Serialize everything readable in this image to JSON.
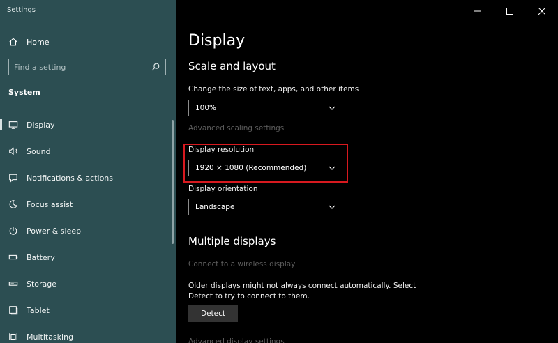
{
  "app": {
    "title": "Settings"
  },
  "sidebar": {
    "home_label": "Home",
    "search_placeholder": "Find a setting",
    "section": "System",
    "items": [
      {
        "label": "Display",
        "icon": "monitor-icon",
        "active": true
      },
      {
        "label": "Sound",
        "icon": "speaker-icon"
      },
      {
        "label": "Notifications & actions",
        "icon": "notification-icon"
      },
      {
        "label": "Focus assist",
        "icon": "moon-icon"
      },
      {
        "label": "Power & sleep",
        "icon": "power-icon"
      },
      {
        "label": "Battery",
        "icon": "battery-icon"
      },
      {
        "label": "Storage",
        "icon": "storage-icon"
      },
      {
        "label": "Tablet",
        "icon": "tablet-icon"
      },
      {
        "label": "Multitasking",
        "icon": "multitasking-icon"
      }
    ]
  },
  "main": {
    "title": "Display",
    "scale_section": "Scale and layout",
    "scale_label": "Change the size of text, apps, and other items",
    "scale_value": "100%",
    "advanced_scaling_link": "Advanced scaling settings",
    "resolution_label": "Display resolution",
    "resolution_value": "1920 × 1080 (Recommended)",
    "orientation_label": "Display orientation",
    "orientation_value": "Landscape",
    "multiple_section": "Multiple displays",
    "wireless_link": "Connect to a wireless display",
    "detect_description": "Older displays might not always connect automatically. Select Detect to try to connect to them.",
    "detect_button": "Detect",
    "advanced_display_link": "Advanced display settings"
  },
  "colors": {
    "sidebar_bg": "#2c4e52",
    "main_bg": "#000000",
    "highlight": "#d7191f"
  }
}
